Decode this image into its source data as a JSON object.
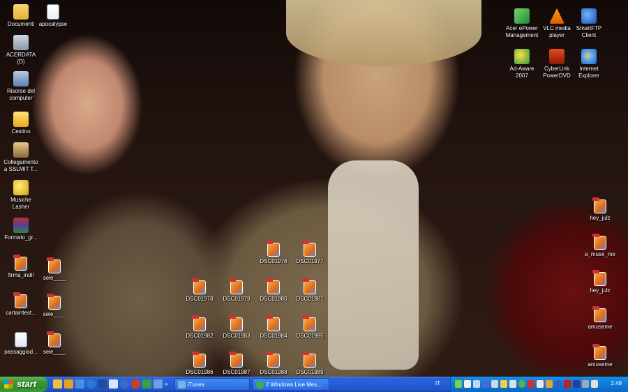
{
  "desktop": {
    "left_icons": [
      {
        "label": "Documenti",
        "icon": "folder-icon"
      },
      {
        "label": "apocalypse",
        "icon": "text-file-icon"
      },
      {
        "label": "ACERDATA (D)",
        "icon": "drive-icon"
      },
      {
        "label": "Risorse del computer",
        "icon": "computer-icon"
      },
      {
        "label": "Cestino",
        "icon": "recycle-bin-icon"
      },
      {
        "label": "Collegamento a SSLMIT T...",
        "icon": "network-shortcut-icon"
      },
      {
        "label": "Musiche Lasher",
        "icon": "music-folder-icon"
      },
      {
        "label": "Formato_gr...",
        "icon": "archive-icon"
      },
      {
        "label": "firma_indil",
        "icon": "image-file-icon"
      },
      {
        "label": "sele____",
        "icon": "image-file-icon"
      },
      {
        "label": "cartaintest...",
        "icon": "image-file-icon"
      },
      {
        "label": "sele____",
        "icon": "image-file-icon"
      },
      {
        "label": "passaggiod...",
        "icon": "document-icon"
      },
      {
        "label": "sele____",
        "icon": "image-file-icon"
      }
    ],
    "photo_icons": [
      {
        "label": "DSC01976"
      },
      {
        "label": "DSC01977"
      },
      {
        "label": "DSC01978"
      },
      {
        "label": "DSC01979"
      },
      {
        "label": "DSC01980"
      },
      {
        "label": "DSC01981"
      },
      {
        "label": "DSC01982"
      },
      {
        "label": "DSC01983"
      },
      {
        "label": "DSC01984"
      },
      {
        "label": "DSC01985"
      },
      {
        "label": "DSC01986"
      },
      {
        "label": "DSC01987"
      },
      {
        "label": "DSC01988"
      },
      {
        "label": "DSC01989"
      }
    ],
    "top_right_icons": [
      {
        "label": "Acer ePower Management",
        "icon": "acer-epower-icon"
      },
      {
        "label": "VLC media player",
        "icon": "vlc-icon"
      },
      {
        "label": "SmartFTP Client",
        "icon": "smartftp-icon"
      },
      {
        "label": "Ad-Aware 2007",
        "icon": "ad-aware-icon"
      },
      {
        "label": "CyberLink PowerDVD",
        "icon": "powerdvd-icon"
      },
      {
        "label": "Internet Explorer",
        "icon": "internet-explorer-icon"
      }
    ],
    "right_column_icons": [
      {
        "label": "hey_julz"
      },
      {
        "label": "a_muse_me"
      },
      {
        "label": "hey_julz"
      },
      {
        "label": "amuseme"
      },
      {
        "label": "amuseme"
      }
    ]
  },
  "taskbar": {
    "start_label": "start",
    "buttons": [
      {
        "label": "iTunes",
        "icon": "itunes-icon",
        "color": "#7bb0e8"
      },
      {
        "label": "2 Windows Live Mes...",
        "icon": "windows-live-messenger-icon",
        "color": "#3fae49"
      }
    ],
    "language": "IT",
    "clock": "2.49"
  },
  "colors": {
    "taskbar_blue": "#245edb",
    "start_green": "#3c9a3a",
    "tray_blue": "#0e7ad8"
  }
}
